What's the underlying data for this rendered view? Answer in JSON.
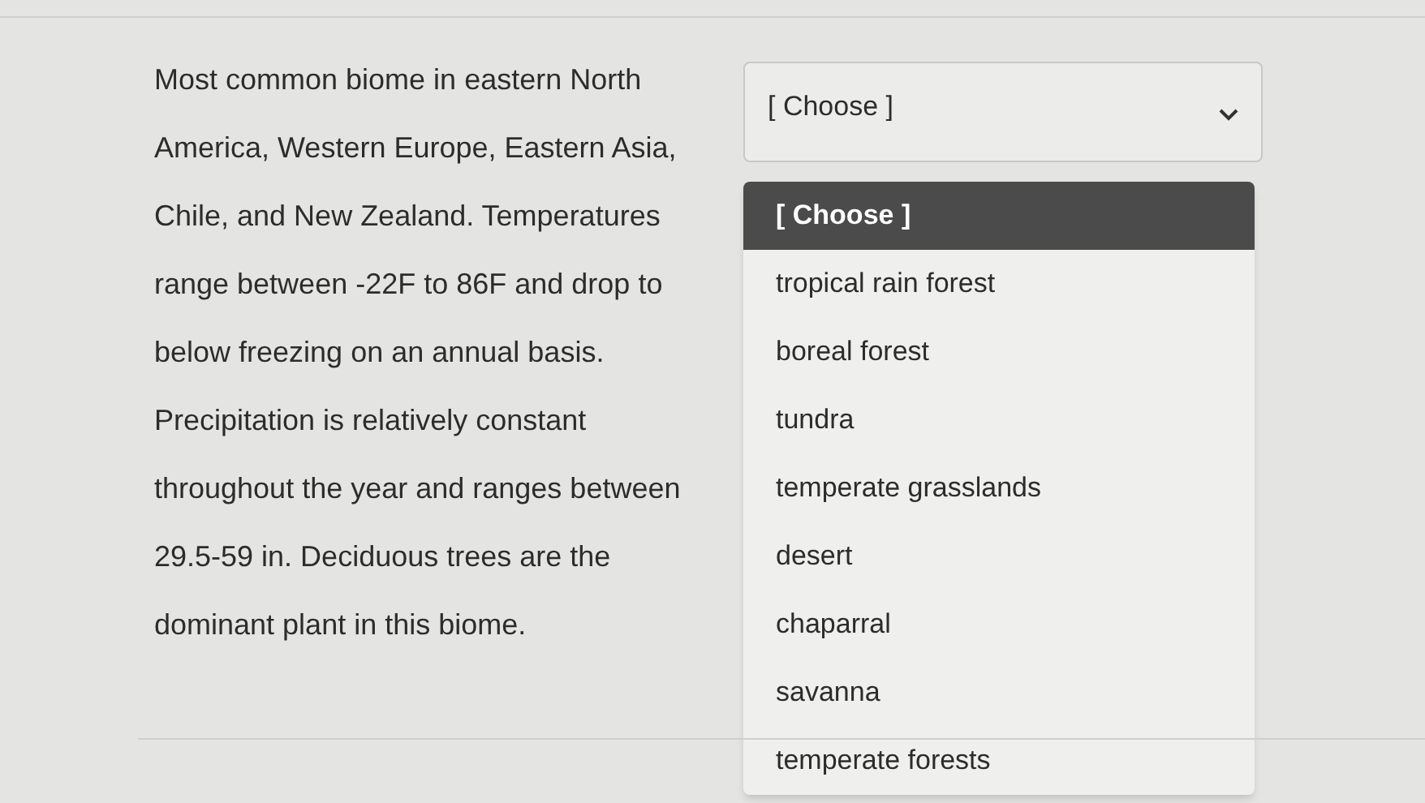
{
  "question": {
    "text": "Most common biome in eastern North America, Western Europe, Eastern Asia, Chile, and New Zealand. Temperatures range between -22F to 86F and drop to below freezing on an annual basis. Precipitation is relatively constant throughout the year and ranges between 29.5-59 in. Deciduous trees are the dominant plant in this biome."
  },
  "dropdown": {
    "value": "[ Choose ]",
    "expanded": true,
    "options": [
      {
        "label": "[ Choose ]",
        "selected": true
      },
      {
        "label": "tropical rain forest",
        "selected": false
      },
      {
        "label": "boreal forest",
        "selected": false
      },
      {
        "label": "tundra",
        "selected": false
      },
      {
        "label": "temperate grasslands",
        "selected": false
      },
      {
        "label": "desert",
        "selected": false
      },
      {
        "label": "chaparral",
        "selected": false
      },
      {
        "label": "savanna",
        "selected": false
      },
      {
        "label": "temperate forests",
        "selected": false
      }
    ]
  }
}
